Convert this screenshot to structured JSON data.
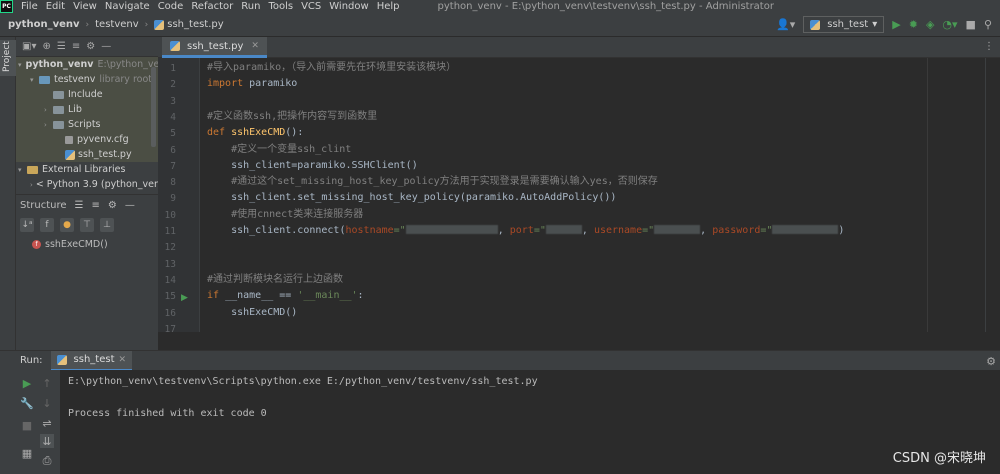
{
  "menubar": {
    "logo": "PC",
    "items": [
      "File",
      "Edit",
      "View",
      "Navigate",
      "Code",
      "Refactor",
      "Run",
      "Tools",
      "VCS",
      "Window",
      "Help"
    ],
    "title": "python_venv - E:\\python_venv\\testvenv\\ssh_test.py - Administrator"
  },
  "breadcrumb": [
    "python_venv",
    "testvenv",
    "ssh_test.py"
  ],
  "run_config": "ssh_test",
  "project_tab": "Project",
  "project_tree": [
    {
      "label": "python_venv",
      "hint": "E:\\python_venv",
      "arrow": "▾",
      "folder": "blue",
      "bold": true,
      "indent": 2
    },
    {
      "label": "testvenv",
      "hint": "library root",
      "arrow": "▾",
      "folder": "blue",
      "indent": 14
    },
    {
      "label": "Include",
      "arrow": "",
      "folder": "gray",
      "indent": 28
    },
    {
      "label": "Lib",
      "arrow": "›",
      "folder": "gray",
      "indent": 28
    },
    {
      "label": "Scripts",
      "arrow": "›",
      "folder": "gray",
      "indent": 28
    },
    {
      "label": "pyvenv.cfg",
      "arrow": "",
      "folder": "file-cfg",
      "indent": 40
    },
    {
      "label": "ssh_test.py",
      "arrow": "",
      "folder": "file-py",
      "indent": 40
    },
    {
      "label": "External Libraries",
      "arrow": "▾",
      "folder": "lib",
      "indent": 2
    },
    {
      "label": "< Python 3.9 (python_venv) >",
      "arrow": "›",
      "folder": "py",
      "indent": 14
    }
  ],
  "structure": {
    "title": "Structure",
    "item": "sshExeCMD()"
  },
  "editor_tab": "ssh_test.py",
  "code_lines": [
    {
      "n": "1",
      "html": "cm:#导入paramiko，（导入前需要先在环境里安装该模块）"
    },
    {
      "n": "2",
      "html": "import paramiko"
    },
    {
      "n": "3",
      "html": ""
    },
    {
      "n": "4",
      "html": "cm:#定义函数ssh,把操作内容写到函数里"
    },
    {
      "n": "5",
      "html": "def sshExeCMD():"
    },
    {
      "n": "6",
      "html": "cm:    #定义一个变量ssh_clint"
    },
    {
      "n": "7",
      "html": "    ssh_client=paramiko.SSHClient()"
    },
    {
      "n": "8",
      "html": "cm:    #通过这个set_missing_host_key_policy方法用于实现登录是需要确认输入yes，否则保存"
    },
    {
      "n": "9",
      "html": "    ssh_client.set_missing_host_key_policy(paramiko.AutoAddPolicy())"
    },
    {
      "n": "10",
      "html": "cm:    #使用cnnect类来连接服务器"
    },
    {
      "n": "11",
      "html": "connect"
    },
    {
      "n": "12",
      "html": ""
    },
    {
      "n": "13",
      "html": ""
    },
    {
      "n": "14",
      "html": "cm:#通过判断模块名运行上边函数"
    },
    {
      "n": "15",
      "html": "ifmain"
    },
    {
      "n": "16",
      "html": "    sshExeCMD()"
    },
    {
      "n": "17",
      "html": ""
    }
  ],
  "code": {
    "import_kw": "import",
    "import_mod": " paramiko",
    "def_kw": "def",
    "def_name": " sshExeCMD",
    "def_tail": "():",
    "connect_head": "    ssh_client.connect(",
    "hostname": "hostname",
    "port": "port",
    "username": "username",
    "password": "password",
    "eq_quote": "=\"",
    "if_kw": "if",
    "main_left": " __name__ == ",
    "main_str": "'__main__'",
    "main_colon": ":"
  },
  "run_panel": {
    "label": "Run:",
    "tab": "ssh_test",
    "line1": "E:\\python_venv\\testvenv\\Scripts\\python.exe E:/python_venv/testvenv/ssh_test.py",
    "line2": "Process finished with exit code 0"
  },
  "watermark": "CSDN @宋晓坤"
}
